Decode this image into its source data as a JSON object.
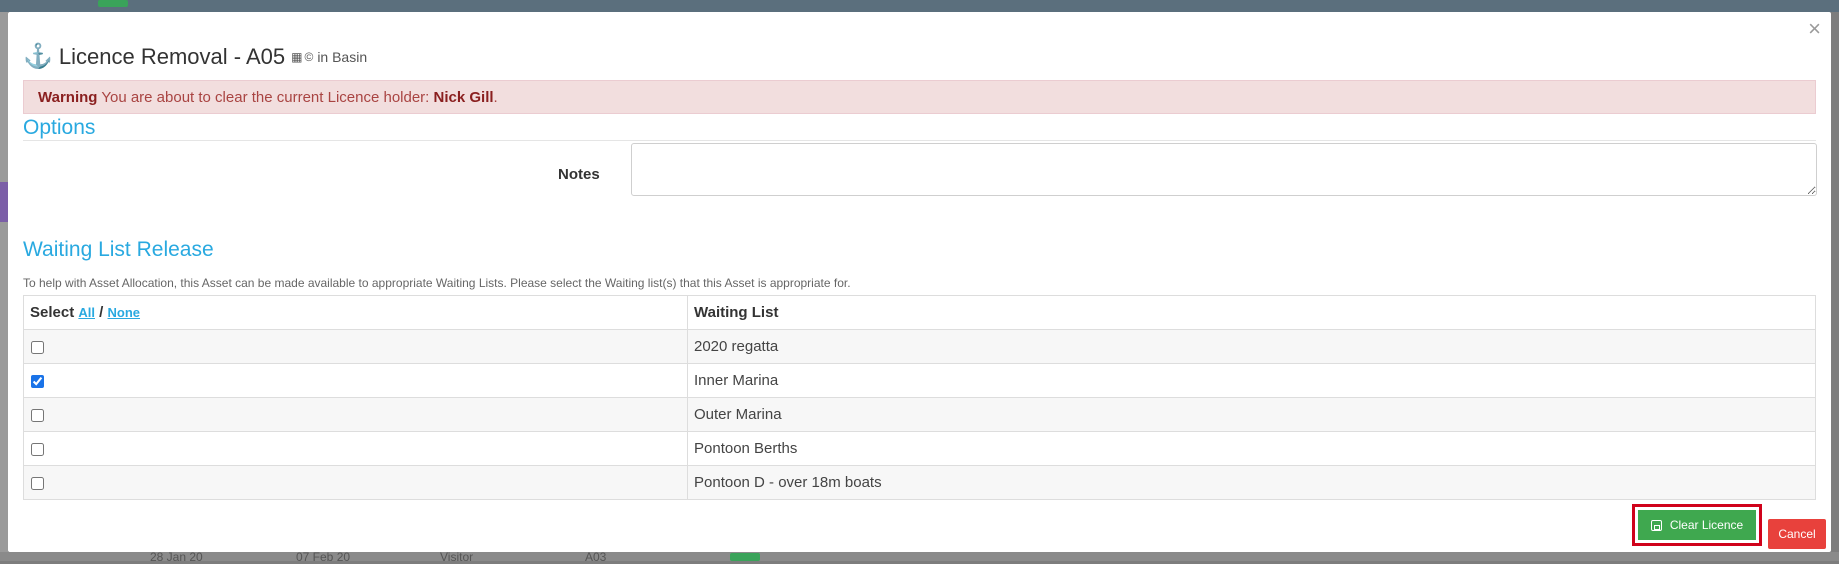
{
  "background": {
    "top_link": "",
    "bottom_row": [
      "28 Jan 20",
      "07 Feb 20",
      "Visitor",
      "A03"
    ]
  },
  "modal": {
    "title": "Licence Removal - A05",
    "location": "in Basin",
    "close_glyph": "×",
    "warning": {
      "label": "Warning",
      "text": "You are about to clear the current Licence holder:",
      "holder": "Nick Gill",
      "end": "."
    },
    "options": {
      "heading": "Options",
      "notes_label": "Notes",
      "notes_value": ""
    },
    "waiting_list": {
      "heading": "Waiting List Release",
      "help": "To help with Asset Allocation, this Asset can be made available to appropriate Waiting Lists. Please select the Waiting list(s) that this Asset is appropriate for.",
      "col_select": "Select",
      "select_all": "All",
      "select_sep": "/",
      "select_none": "None",
      "col_list": "Waiting List",
      "rows": [
        {
          "name": "2020 regatta",
          "checked": false
        },
        {
          "name": "Inner Marina",
          "checked": true
        },
        {
          "name": "Outer Marina",
          "checked": false
        },
        {
          "name": "Pontoon Berths",
          "checked": false
        },
        {
          "name": "Pontoon D - over 18m boats",
          "checked": false
        }
      ]
    },
    "buttons": {
      "clear": "Clear Licence",
      "cancel": "Cancel"
    },
    "colors": {
      "accent": "#29a9e0",
      "alert_bg": "#f2dede",
      "clear_btn": "#3fa84f",
      "cancel_btn": "#e8413c",
      "highlight": "#d0021b"
    }
  }
}
